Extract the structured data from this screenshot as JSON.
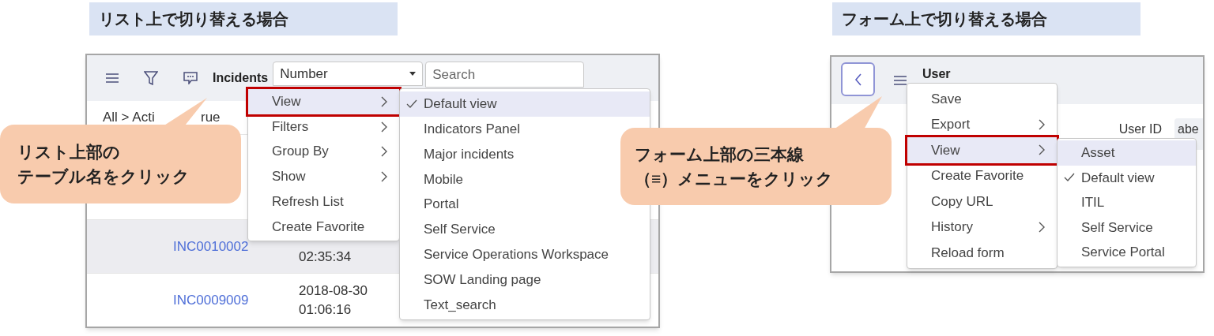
{
  "list_example": {
    "heading": "リスト上で切り替える場合",
    "toolbar": {
      "table_name": "Incidents",
      "field_select": "Number",
      "search": {
        "placeholder": "Search"
      }
    },
    "breadcrumb": [
      "All > Acti",
      "rue"
    ],
    "rows": [
      {
        "number": "INC0010002",
        "time": [
          "02:35:34"
        ],
        "shaded": true
      },
      {
        "number": "INC0009009",
        "time": [
          "2018-08-30",
          "01:06:16"
        ],
        "shaded": false
      }
    ],
    "menu": [
      {
        "label": "View",
        "submenu": true,
        "highlighted": true,
        "annotated": true
      },
      {
        "label": "Filters",
        "submenu": true,
        "highlighted": false,
        "annotated": false
      },
      {
        "label": "Group By",
        "submenu": true,
        "highlighted": false,
        "annotated": false
      },
      {
        "label": "Show",
        "submenu": true,
        "highlighted": false,
        "annotated": false
      },
      {
        "label": "Refresh List",
        "submenu": false,
        "highlighted": false,
        "annotated": false
      },
      {
        "label": "Create Favorite",
        "submenu": false,
        "highlighted": false,
        "annotated": false
      }
    ],
    "submenu": [
      {
        "label": "Default view",
        "checked": true,
        "highlighted": true
      },
      {
        "label": "Indicators Panel",
        "checked": false,
        "highlighted": false
      },
      {
        "label": "Major incidents",
        "checked": false,
        "highlighted": false
      },
      {
        "label": "Mobile",
        "checked": false,
        "highlighted": false
      },
      {
        "label": "Portal",
        "checked": false,
        "highlighted": false
      },
      {
        "label": "Self Service",
        "checked": false,
        "highlighted": false
      },
      {
        "label": "Service Operations Workspace",
        "checked": false,
        "highlighted": false
      },
      {
        "label": "SOW Landing page",
        "checked": false,
        "highlighted": false
      },
      {
        "label": "Text_search",
        "checked": false,
        "highlighted": false
      }
    ],
    "callout": [
      "リスト上部の",
      "テーブル名をクリック"
    ]
  },
  "form_example": {
    "heading": "フォーム上で切り替える場合",
    "title": "User",
    "field_label": "User ID",
    "field_value": "abe",
    "menu": [
      {
        "label": "Save",
        "submenu": false,
        "highlighted": false,
        "annotated": false
      },
      {
        "label": "Export",
        "submenu": true,
        "highlighted": false,
        "annotated": false
      },
      {
        "label": "View",
        "submenu": true,
        "highlighted": true,
        "annotated": true
      },
      {
        "label": "Create Favorite",
        "submenu": false,
        "highlighted": false,
        "annotated": false
      },
      {
        "label": "Copy URL",
        "submenu": false,
        "highlighted": false,
        "annotated": false
      },
      {
        "label": "History",
        "submenu": true,
        "highlighted": false,
        "annotated": false
      },
      {
        "label": "Reload form",
        "submenu": false,
        "highlighted": false,
        "annotated": false
      }
    ],
    "submenu": [
      {
        "label": "Asset",
        "checked": false,
        "highlighted": true
      },
      {
        "label": "Default view",
        "checked": true,
        "highlighted": false
      },
      {
        "label": "ITIL",
        "checked": false,
        "highlighted": false
      },
      {
        "label": "Self Service",
        "checked": false,
        "highlighted": false
      },
      {
        "label": "Service Portal",
        "checked": false,
        "highlighted": false
      }
    ],
    "callout": [
      "フォーム上部の三本線",
      "（≡）メニューをクリック"
    ]
  }
}
